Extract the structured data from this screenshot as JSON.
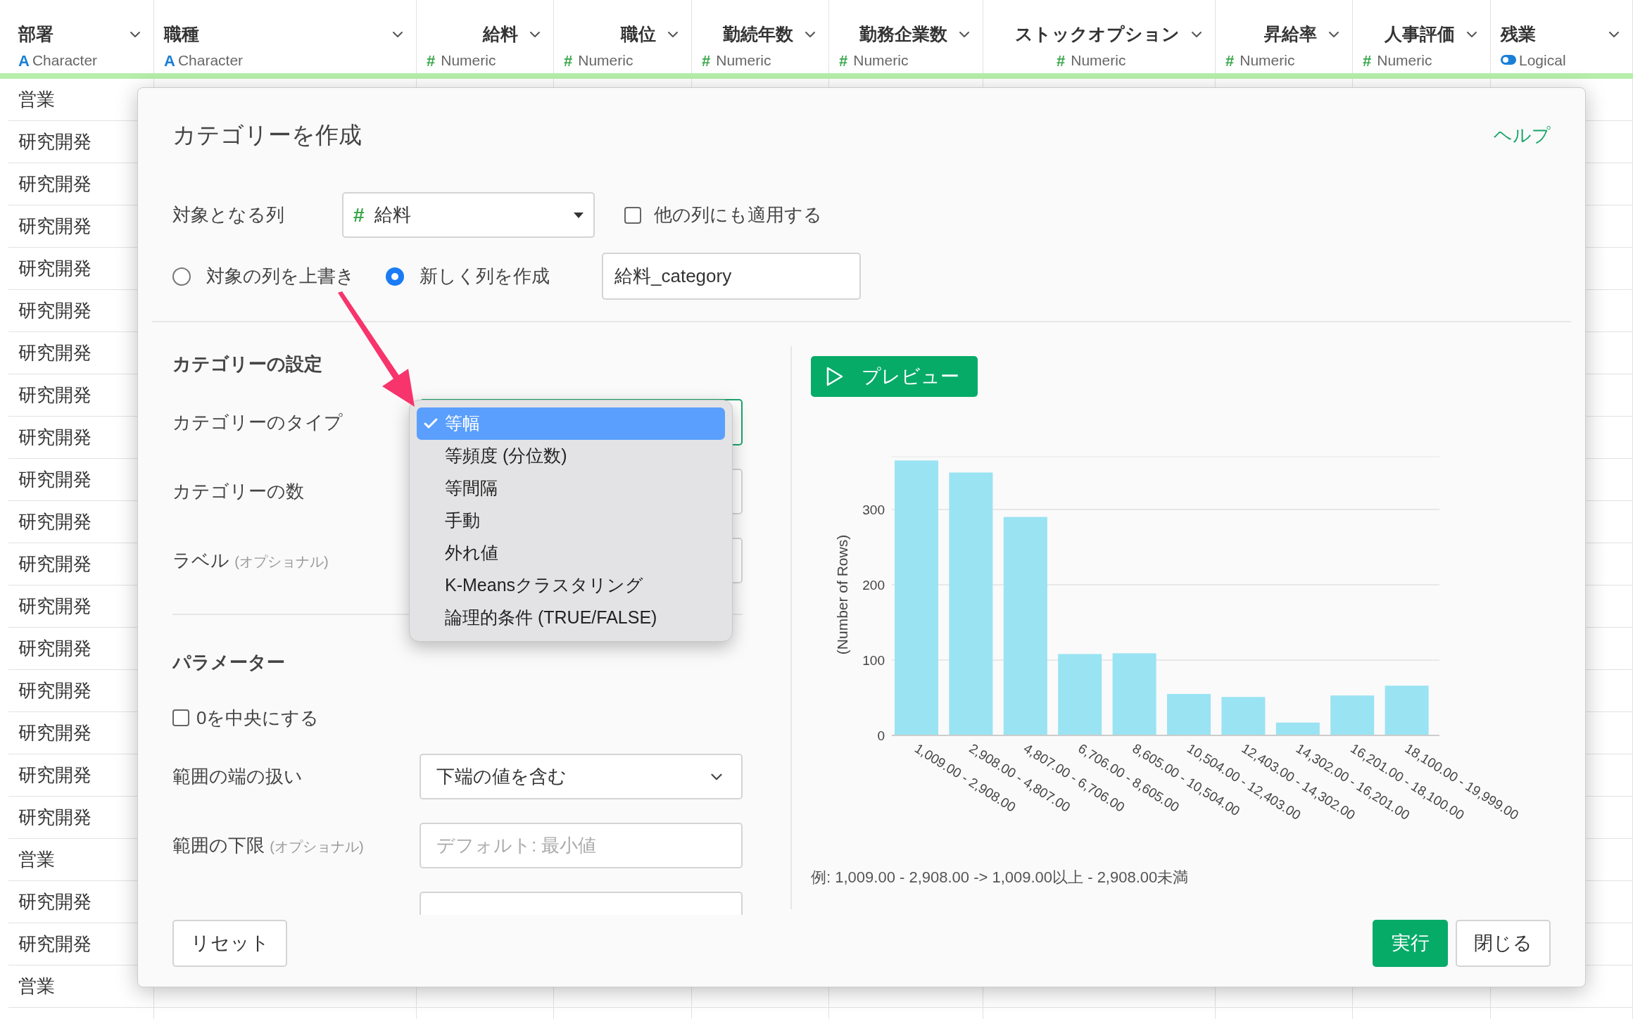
{
  "columns": [
    {
      "name": "部署",
      "kind": "character",
      "icon": "A",
      "type": "Character"
    },
    {
      "name": "職種",
      "kind": "character",
      "icon": "A",
      "type": "Character"
    },
    {
      "name": "給料",
      "kind": "numeric",
      "icon": "#",
      "type": "Numeric"
    },
    {
      "name": "職位",
      "kind": "numeric",
      "icon": "#",
      "type": "Numeric"
    },
    {
      "name": "勤続年数",
      "kind": "numeric",
      "icon": "#",
      "type": "Numeric"
    },
    {
      "name": "勤務企業数",
      "kind": "numeric",
      "icon": "#",
      "type": "Numeric"
    },
    {
      "name": "ストックオプション",
      "kind": "numeric",
      "icon": "#",
      "type": "Numeric"
    },
    {
      "name": "昇給率",
      "kind": "numeric",
      "icon": "#",
      "type": "Numeric"
    },
    {
      "name": "人事評価",
      "kind": "numeric",
      "icon": "#",
      "type": "Numeric"
    },
    {
      "name": "残業",
      "kind": "logical",
      "type": "Logical"
    }
  ],
  "rows": [
    {
      "cells": [
        "営業"
      ]
    },
    {
      "cells": [
        "研究開発"
      ]
    },
    {
      "cells": [
        "研究開発"
      ]
    },
    {
      "cells": [
        "研究開発"
      ]
    },
    {
      "cells": [
        "研究開発"
      ]
    },
    {
      "cells": [
        "研究開発"
      ]
    },
    {
      "cells": [
        "研究開発"
      ]
    },
    {
      "cells": [
        "研究開発"
      ]
    },
    {
      "cells": [
        "研究開発"
      ]
    },
    {
      "cells": [
        "研究開発"
      ]
    },
    {
      "cells": [
        "研究開発"
      ]
    },
    {
      "cells": [
        "研究開発"
      ]
    },
    {
      "cells": [
        "研究開発"
      ]
    },
    {
      "cells": [
        "研究開発"
      ]
    },
    {
      "cells": [
        "研究開発"
      ]
    },
    {
      "cells": [
        "研究開発"
      ]
    },
    {
      "cells": [
        "研究開発"
      ]
    },
    {
      "cells": [
        "研究開発"
      ]
    },
    {
      "cells": [
        "営業"
      ]
    },
    {
      "cells": [
        "研究開発"
      ]
    },
    {
      "cells": [
        "研究開発"
      ]
    },
    {
      "cells": [
        "営業"
      ]
    }
  ],
  "dialog": {
    "title": "カテゴリーを作成",
    "help_link": "ヘルプ",
    "target_column": {
      "label": "対象となる列",
      "icon": "#",
      "value": "給料"
    },
    "apply_other": {
      "label": "他の列にも適用する",
      "checked": false
    },
    "output_mode": [
      {
        "label": "対象の列を上書き",
        "selected": false
      },
      {
        "label": "新しく列を作成",
        "selected": true
      }
    ],
    "new_column_name": {
      "value": "給料_category"
    },
    "settings": {
      "heading": "カテゴリーの設定",
      "type_label": "カテゴリーのタイプ",
      "count_label": "カテゴリーの数",
      "label_label": "ラベル",
      "label_optional": "(オプショナル)"
    },
    "type_menu": [
      {
        "label": "等幅",
        "selected": true
      },
      {
        "label": "等頻度 (分位数)",
        "selected": false
      },
      {
        "label": "等間隔",
        "selected": false
      },
      {
        "label": "手動",
        "selected": false
      },
      {
        "label": "外れ値",
        "selected": false
      },
      {
        "label": "K-Meansクラスタリング",
        "selected": false
      },
      {
        "label": "論理的条件 (TRUE/FALSE)",
        "selected": false
      }
    ],
    "parameters": {
      "heading": "パラメーター",
      "center_zero": {
        "label": "0を中央にする",
        "checked": false
      },
      "edge": {
        "label": "範囲の端の扱い",
        "value": "下端の値を含む"
      },
      "lower": {
        "label": "範囲の下限",
        "optional": "(オプショナル)",
        "placeholder": "デフォルト: 最小値"
      }
    },
    "preview_button": "プレビュー",
    "chart_data": {
      "type": "bar",
      "ylabel": "(Number of Rows)",
      "categories": [
        "1,009.00 - 2,908.00",
        "2,908.00 - 4,807.00",
        "4,807.00 - 6,706.00",
        "6,706.00 - 8,605.00",
        "8,605.00 - 10,504.00",
        "10,504.00 - 12,403.00",
        "12,403.00 - 14,302.00",
        "14,302.00 - 16,201.00",
        "16,201.00 - 18,100.00",
        "18,100.00 - 19,999.00"
      ],
      "values": [
        365,
        349,
        290,
        108,
        109,
        55,
        51,
        17,
        53,
        66
      ],
      "grid": true,
      "ylim": [
        0,
        370
      ],
      "yticks": [
        0,
        100,
        200,
        300
      ]
    },
    "example": "例: 1,009.00 - 2,908.00 -> 1,009.00以上 - 2,908.00未満",
    "buttons": {
      "reset": "リセット",
      "run": "実行",
      "close": "閉じる"
    }
  }
}
